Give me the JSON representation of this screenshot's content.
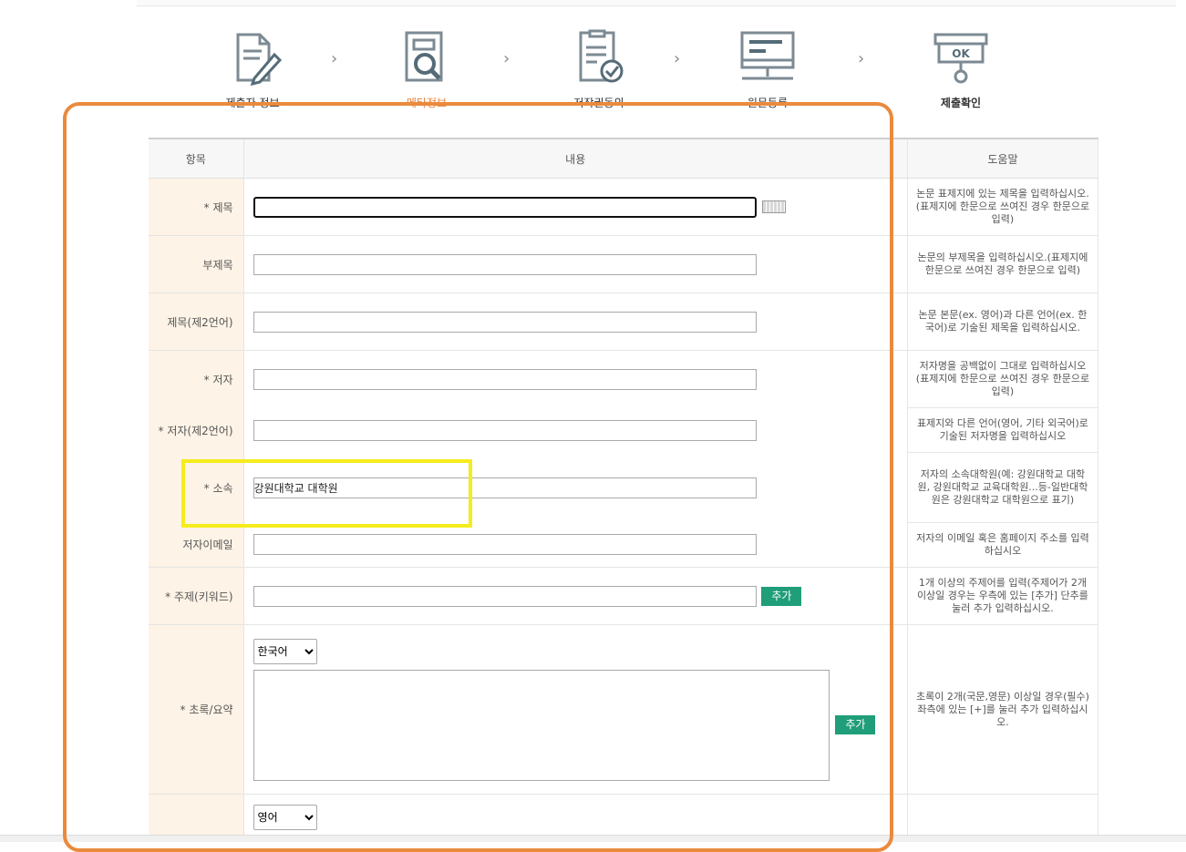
{
  "steps": [
    {
      "label": "제출자 정보",
      "icon": "document-pencil-icon",
      "state": "done"
    },
    {
      "label": "메타정보",
      "icon": "document-magnifier-icon",
      "state": "active"
    },
    {
      "label": "저작권동의",
      "icon": "document-check-icon",
      "state": "pending"
    },
    {
      "label": "원문등록",
      "icon": "monitor-icon",
      "state": "pending"
    },
    {
      "label": "제출확인",
      "icon": "ok-stamp-icon",
      "state": "pending"
    }
  ],
  "colors": {
    "accent_orange": "#ea8a3c",
    "highlight_yellow": "#f5ec1d",
    "add_button": "#1f9e79",
    "label_bg": "#fdf3e6"
  },
  "table": {
    "headers": {
      "item": "항목",
      "content": "내용",
      "help": "도움말"
    },
    "rows": {
      "title": {
        "label": "* 제목",
        "value": "",
        "help": "논문 표제지에 있는 제목을 입력하십시오.(표제지에 한문으로 쓰여진 경우 한문으로 입력)"
      },
      "subtitle": {
        "label": "부제목",
        "value": "",
        "help": "논문의 부제목을 입력하십시오.(표제지에 한문으로 쓰여진 경우 한문으로 입력)"
      },
      "title2": {
        "label": "제목(제2언어)",
        "value": "",
        "help": "논문 본문(ex. 영어)과 다른 언어(ex. 한국어)로 기술된 제목을 입력하십시오."
      },
      "author": {
        "label": "* 저자",
        "value": "",
        "help": "저자명을 공백없이 그대로 입력하십시오(표제지에 한문으로 쓰여진 경우 한문으로 입력)"
      },
      "author2": {
        "label": "* 저자(제2언어)",
        "value": "",
        "help": "표제지와 다른 언어(영어, 기타 외국어)로 기술된 저자명을 입력하십시오"
      },
      "affiliation": {
        "label": "* 소속",
        "value": "강원대학교 대학원",
        "help": "저자의 소속대학원(예: 강원대학교 대학원, 강원대학교 교육대학원...등-일반대학원은 강원대학교 대학원으로 표기)"
      },
      "email": {
        "label": "저자이메일",
        "value": "",
        "help": "저자의 이메일 혹은 홈페이지 주소를 입력하십시오"
      },
      "keyword": {
        "label": "* 주제(키워드)",
        "value": "",
        "button": "추가",
        "help": "1개 이상의 주제어를 입력(주제어가 2개 이상일 경우는 우측에 있는 [추가] 단추를 눌러 추가 입력하십시오."
      },
      "abstract": {
        "label": "* 초록/요약",
        "language": "한국어",
        "value": "",
        "button": "추가",
        "help": "초록이 2개(국문,영문) 이상일 경우(필수)좌측에 있는 [+]를 눌러 추가 입력하십시오."
      },
      "abstract2": {
        "label": "",
        "language": "영어"
      }
    }
  }
}
